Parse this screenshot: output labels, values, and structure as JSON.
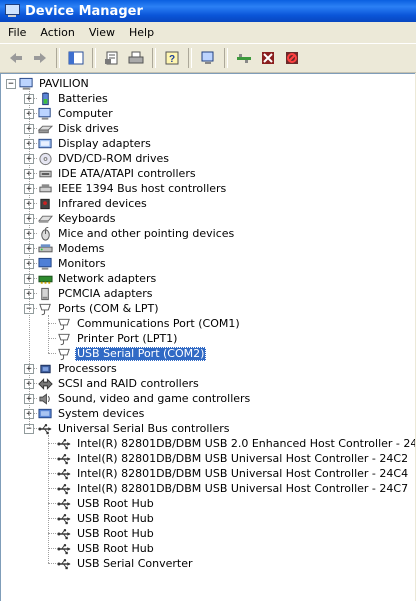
{
  "window": {
    "title": "Device Manager"
  },
  "menu": [
    "File",
    "Action",
    "View",
    "Help"
  ],
  "toolbar": {
    "buttons": [
      "back-icon",
      "forward-icon",
      "show-hide-tree-icon",
      "properties-icon",
      "print-icon",
      "help-icon",
      "scan-hardware-icon",
      "update-driver-icon",
      "uninstall-icon",
      "disable-icon"
    ],
    "colors": {
      "accent": "#316ac5",
      "title": "#0a55d8"
    }
  },
  "tree": {
    "root": "PAVILION",
    "categories": [
      {
        "label": "Batteries",
        "icon": "battery-icon",
        "expanded": false
      },
      {
        "label": "Computer",
        "icon": "computer-icon",
        "expanded": false
      },
      {
        "label": "Disk drives",
        "icon": "disk-drive-icon",
        "expanded": false
      },
      {
        "label": "Display adapters",
        "icon": "display-adapter-icon",
        "expanded": false
      },
      {
        "label": "DVD/CD-ROM drives",
        "icon": "dvd-drive-icon",
        "expanded": false
      },
      {
        "label": "IDE ATA/ATAPI controllers",
        "icon": "ide-controller-icon",
        "expanded": false
      },
      {
        "label": "IEEE 1394 Bus host controllers",
        "icon": "firewire-icon",
        "expanded": false
      },
      {
        "label": "Infrared devices",
        "icon": "infrared-icon",
        "expanded": false
      },
      {
        "label": "Keyboards",
        "icon": "keyboard-icon",
        "expanded": false
      },
      {
        "label": "Mice and other pointing devices",
        "icon": "mouse-icon",
        "expanded": false
      },
      {
        "label": "Modems",
        "icon": "modem-icon",
        "expanded": false
      },
      {
        "label": "Monitors",
        "icon": "monitor-icon",
        "expanded": false
      },
      {
        "label": "Network adapters",
        "icon": "network-adapter-icon",
        "expanded": false
      },
      {
        "label": "PCMCIA adapters",
        "icon": "pcmcia-icon",
        "expanded": false
      },
      {
        "label": "Ports (COM & LPT)",
        "icon": "port-icon",
        "expanded": true,
        "children": [
          {
            "label": "Communications Port (COM1)",
            "icon": "port-icon"
          },
          {
            "label": "Printer Port (LPT1)",
            "icon": "port-icon"
          },
          {
            "label": "USB Serial Port (COM2)",
            "icon": "port-icon",
            "selected": true
          }
        ]
      },
      {
        "label": "Processors",
        "icon": "processor-icon",
        "expanded": false
      },
      {
        "label": "SCSI and RAID controllers",
        "icon": "scsi-icon",
        "expanded": false
      },
      {
        "label": "Sound, video and game controllers",
        "icon": "sound-icon",
        "expanded": false
      },
      {
        "label": "System devices",
        "icon": "system-device-icon",
        "expanded": false
      },
      {
        "label": "Universal Serial Bus controllers",
        "icon": "usb-icon",
        "expanded": true,
        "children": [
          {
            "label": "Intel(R) 82801DB/DBM USB 2.0 Enhanced Host Controller - 24CD",
            "icon": "usb-icon"
          },
          {
            "label": "Intel(R) 82801DB/DBM USB Universal Host Controller - 24C2",
            "icon": "usb-icon"
          },
          {
            "label": "Intel(R) 82801DB/DBM USB Universal Host Controller - 24C4",
            "icon": "usb-icon"
          },
          {
            "label": "Intel(R) 82801DB/DBM USB Universal Host Controller - 24C7",
            "icon": "usb-icon"
          },
          {
            "label": "USB Root Hub",
            "icon": "usb-icon"
          },
          {
            "label": "USB Root Hub",
            "icon": "usb-icon"
          },
          {
            "label": "USB Root Hub",
            "icon": "usb-icon"
          },
          {
            "label": "USB Root Hub",
            "icon": "usb-icon"
          },
          {
            "label": "USB Serial Converter",
            "icon": "usb-icon"
          }
        ]
      }
    ]
  }
}
